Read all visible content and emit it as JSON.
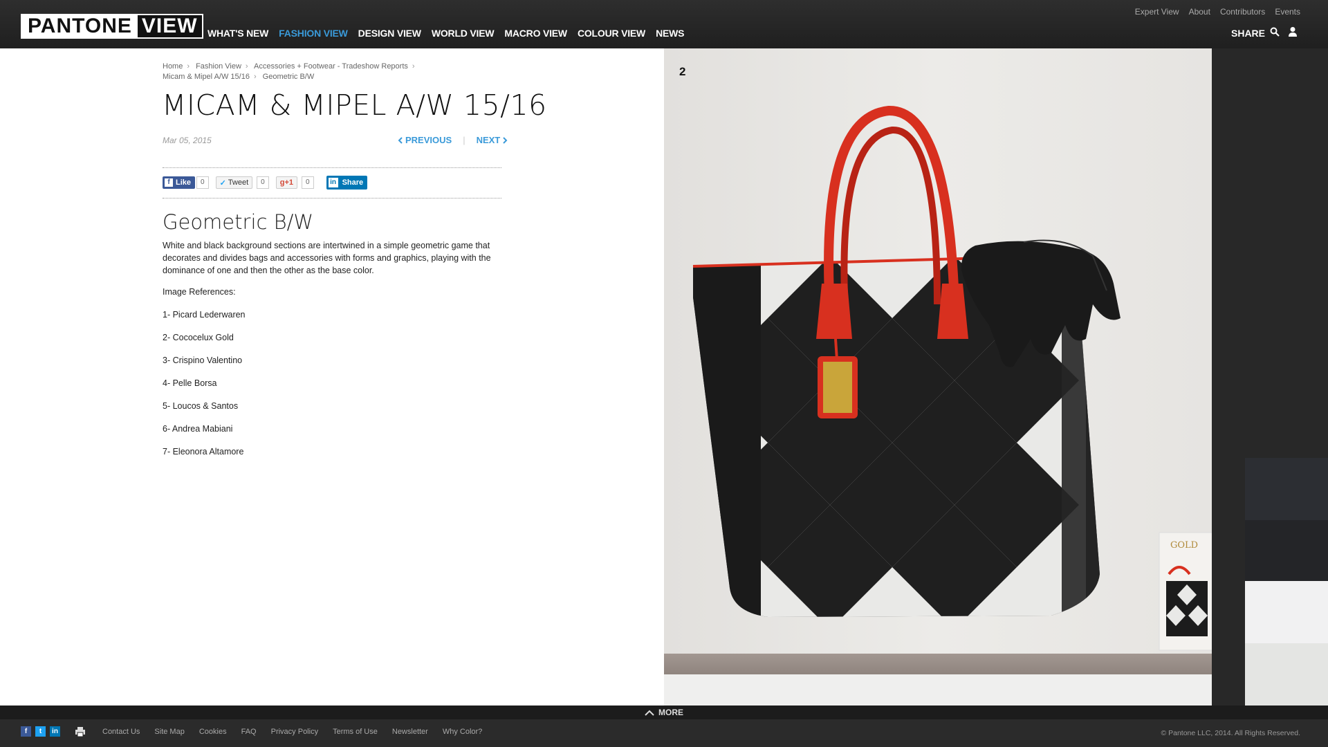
{
  "header": {
    "logo_left": "PANTONE",
    "logo_right": "VIEW",
    "nav": [
      "WHAT'S NEW",
      "FASHION VIEW",
      "DESIGN VIEW",
      "WORLD VIEW",
      "MACRO VIEW",
      "COLOUR VIEW",
      "NEWS"
    ],
    "active_nav": "FASHION VIEW",
    "util": [
      "Expert View",
      "About",
      "Contributors",
      "Events"
    ],
    "share_label": "SHARE"
  },
  "breadcrumb": {
    "items": [
      "Home",
      "Fashion View",
      "Accessories + Footwear - Tradeshow Reports",
      "Micam & Mipel A/W 15/16",
      "Geometric B/W"
    ]
  },
  "article": {
    "title": "MICAM & MIPEL A/W 15/16",
    "date": "Mar 05, 2015",
    "prev_label": "PREVIOUS",
    "next_label": "NEXT",
    "section_title": "Geometric B/W",
    "description": "White and black background sections are intertwined in a simple geometric game that decorates and divides bags and accessories with forms and graphics, playing with the dominance of one and then the other as the base color.",
    "refs_title": "Image References:",
    "refs": [
      "1- Picard Lederwaren",
      "2- Cococelux Gold",
      "3- Crispino Valentino",
      "4- Pelle Borsa",
      "5- Loucos & Santos",
      "6- Andrea Mabiani",
      "7- Eleonora Altamore"
    ]
  },
  "social": {
    "like_label": "Like",
    "like_count": "0",
    "tweet_label": "Tweet",
    "tweet_count": "0",
    "gplus_label": "+1",
    "gplus_count": "0",
    "linkedin_label": "Share"
  },
  "photo": {
    "number": "2",
    "tag_text": "GOLD",
    "colors": {
      "bag_black": "#1c1c1c",
      "bag_white": "#e9e9e7",
      "handle_red": "#d8301f",
      "tag_gold": "#c9a53a"
    }
  },
  "sidebar_swatches": [
    "#2c2e33",
    "#242528",
    "#f1f1f2",
    "#e4e5e3"
  ],
  "footer": {
    "more_label": "MORE",
    "links": [
      "Contact Us",
      "Site Map",
      "Cookies",
      "FAQ",
      "Privacy Policy",
      "Terms of Use",
      "Newsletter",
      "Why Color?"
    ],
    "copyright": "© Pantone LLC, 2014. All Rights Reserved."
  }
}
